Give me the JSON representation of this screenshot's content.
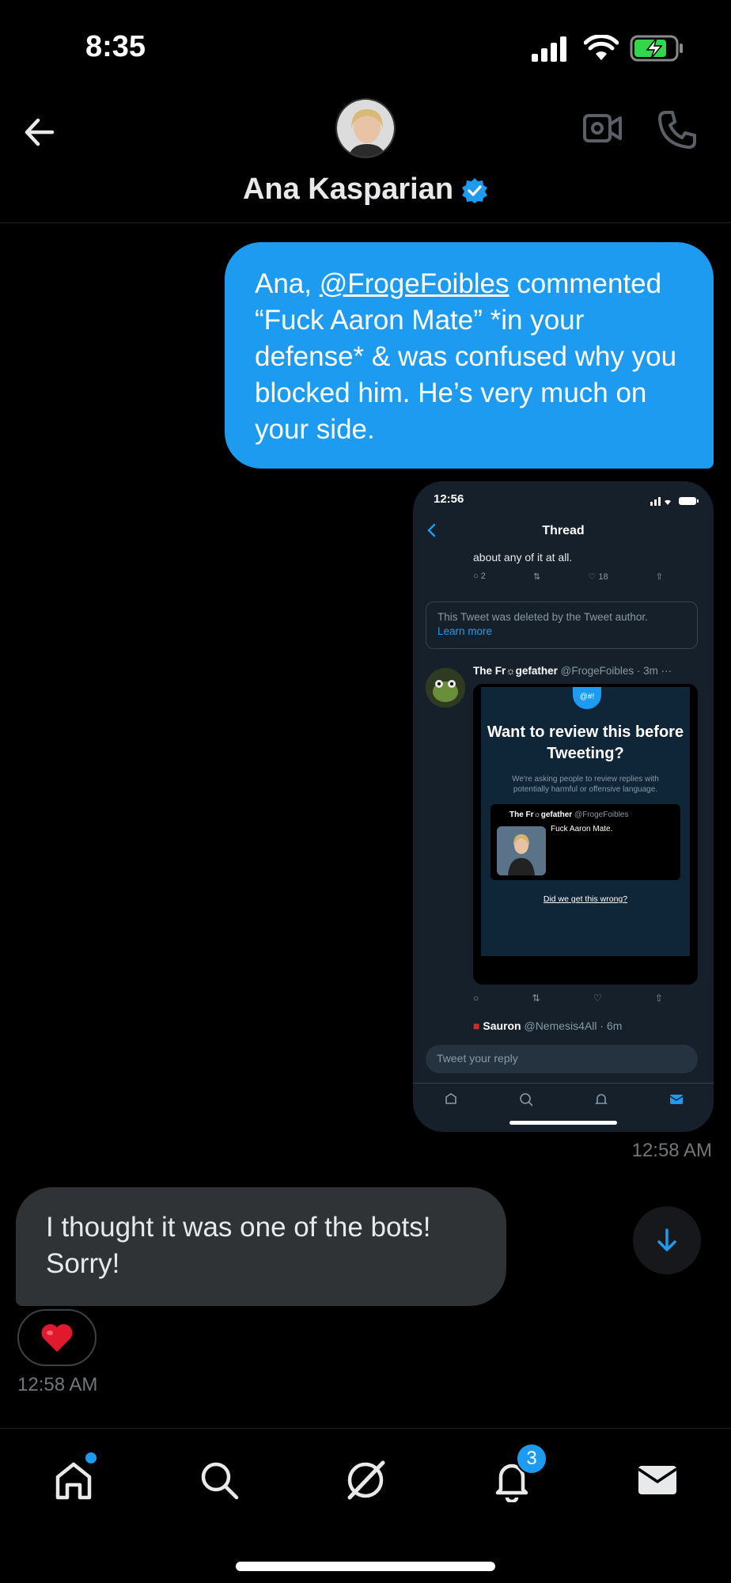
{
  "status_bar": {
    "time": "8:35"
  },
  "header": {
    "contact_name": "Ana Kasparian"
  },
  "messages": {
    "outgoing": {
      "prefix": "Ana, ",
      "mention": "@FrogeFoibles",
      "body": " commented “Fuck Aaron Mate” *in your defense* & was confused why you blocked him. He’s very much on your side.",
      "timestamp": "12:58 AM"
    },
    "incoming": {
      "text": "I thought it was one of the bots! Sorry!",
      "reaction": "❤️",
      "timestamp": "12:58 AM"
    }
  },
  "screenshot": {
    "time": "12:56",
    "title": "Thread",
    "prev_text": "about any of it at all.",
    "prev_counts": {
      "replies": "2",
      "likes": "18"
    },
    "deleted_notice": "This Tweet was deleted by the Tweet author.",
    "learn_more": "Learn more",
    "author_name": "The Fr☼gefather",
    "author_handle": "@FrogeFoibles · 3m",
    "card": {
      "badge": "@#!",
      "title": "Want to review this before Tweeting?",
      "subtitle": "We're asking people to review replies with potentially harmful or offensive language.",
      "tweet_author": "The Fr☼gefather",
      "tweet_handle": "@FrogeFoibles",
      "tweet_text": "Fuck Aaron Mate.",
      "link": "Did we get this wrong?"
    },
    "next_author": "Sauron",
    "next_handle": "@Nemesis4All · 6m",
    "reply_placeholder": "Tweet your reply"
  },
  "bottom_nav": {
    "notification_count": "3"
  },
  "colors": {
    "accent": "#1d9bf0",
    "bubble_in": "#2f3336",
    "background": "#000000"
  }
}
